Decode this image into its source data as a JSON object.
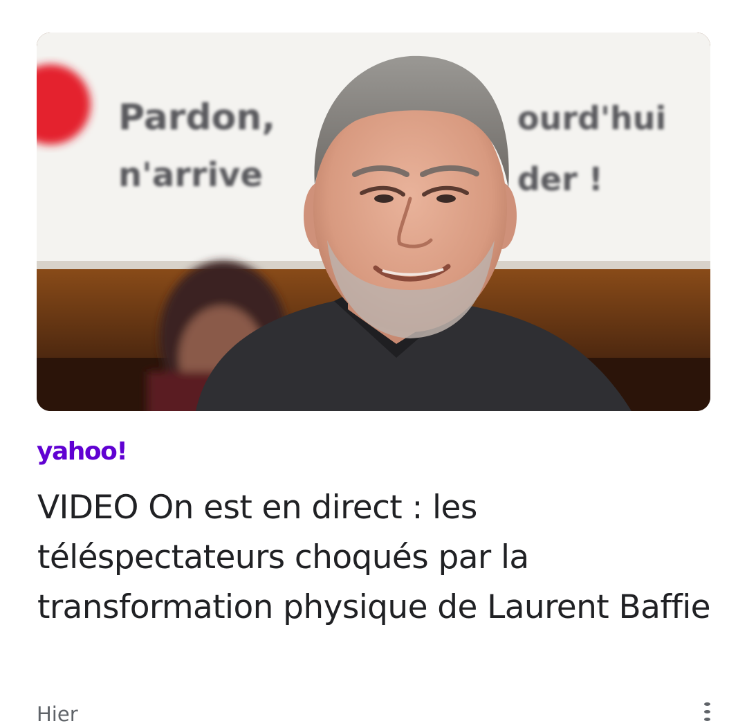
{
  "article": {
    "image": {
      "alt": "Pardon, aujourd'hui je n'arrive pas à regarder !",
      "screen_text_line1": "Pardon,",
      "screen_text_line1b": "ourd'hui",
      "screen_text_line2": "n'arrive",
      "screen_text_line2b": "der !"
    },
    "source": {
      "name": "yahoo!",
      "color": "#6001d2"
    },
    "headline": "VIDEO On est en direct : les téléspectateurs choqués par la transformation physique de Laurent Baffie",
    "timestamp": "Hier",
    "more_icon": "more-vert-icon",
    "colors": {
      "headline": "#202124",
      "timestamp": "#5f6368",
      "more_icon": "#5f6368"
    }
  }
}
